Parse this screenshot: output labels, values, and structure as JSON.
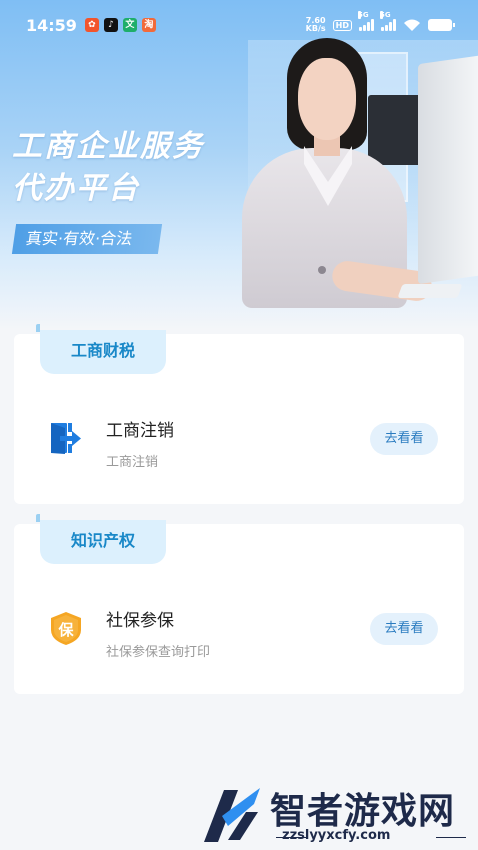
{
  "status_bar": {
    "time": "14:59",
    "net_speed_value": "7.60",
    "net_speed_unit": "KB/s",
    "hd_label": "HD",
    "signal_1": "5G",
    "signal_2": "5G",
    "notif_icons": [
      "app-icon-orange",
      "tiktok-icon",
      "app-icon-green",
      "app-icon-orange-2"
    ]
  },
  "hero": {
    "title_line1": "工商企业服务",
    "title_line2": "代办平台",
    "tagline": "真实·有效·合法"
  },
  "sections": [
    {
      "tab_label": "工商财税",
      "item_title": "工商注销",
      "item_subtitle": "工商注销",
      "action_label": "去看看",
      "icon": "exit-door-icon"
    },
    {
      "tab_label": "知识产权",
      "item_title": "社保参保",
      "item_subtitle": "社保参保查询打印",
      "action_label": "去看看",
      "icon": "shield-bao-icon",
      "icon_glyph": "保"
    }
  ],
  "watermark": {
    "name": "智者游戏网",
    "url": "zzslyyxcfy.com"
  },
  "colors": {
    "accent": "#1988c8",
    "tab_bg": "#dcf0fd",
    "button_bg": "#e4f1fc",
    "shield_orange": "#f5a623"
  }
}
